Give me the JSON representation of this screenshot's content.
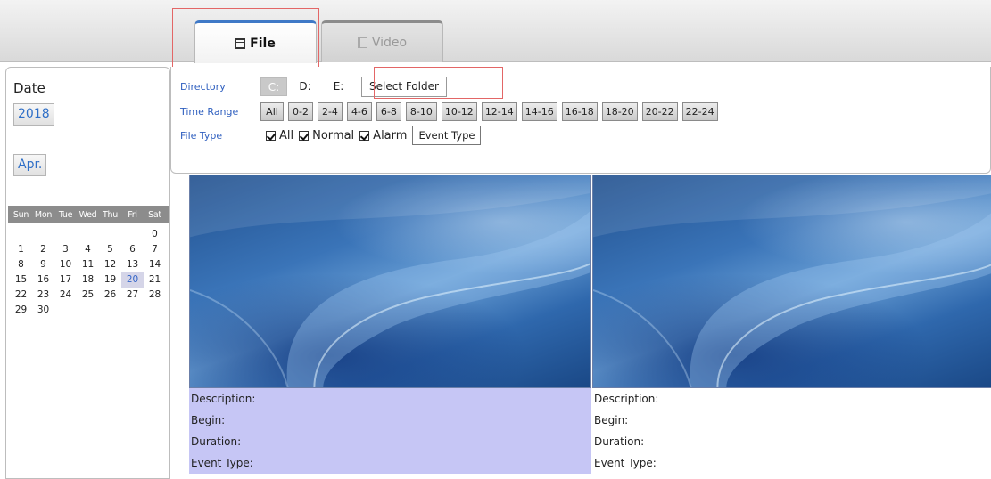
{
  "tabs": [
    {
      "label": "File",
      "active": true
    },
    {
      "label": "Video",
      "active": false
    }
  ],
  "left": {
    "date_label": "Date",
    "year": "2018",
    "month": "Apr.",
    "weekdays": [
      "Sun",
      "Mon",
      "Tue",
      "Wed",
      "Thu",
      "Fri",
      "Sat"
    ],
    "days": [
      "",
      "",
      "",
      "",
      "",
      "",
      "0",
      "1",
      "2",
      "3",
      "4",
      "5",
      "6",
      "7",
      "8",
      "9",
      "10",
      "11",
      "12",
      "13",
      "14",
      "15",
      "16",
      "17",
      "18",
      "19",
      "20",
      "21",
      "22",
      "23",
      "24",
      "25",
      "26",
      "27",
      "28",
      "29",
      "30"
    ],
    "selected_day": "20"
  },
  "filter": {
    "directory_label": "Directory",
    "drive_c": "C:",
    "drive_d": "D:",
    "drive_e": "E:",
    "select_folder": "Select Folder",
    "time_range_label": "Time Range",
    "time_ranges": [
      "All",
      "0-2",
      "2-4",
      "4-6",
      "6-8",
      "8-10",
      "10-12",
      "12-14",
      "14-16",
      "16-18",
      "18-20",
      "20-22",
      "22-24"
    ],
    "file_type_label": "File Type",
    "file_types": [
      "All",
      "Normal",
      "Alarm"
    ],
    "event_type_button": "Event Type"
  },
  "cards": [
    {
      "description": "Description:",
      "begin": "Begin:",
      "duration": "Duration:",
      "event_type": "Event Type:"
    },
    {
      "description": "Description:",
      "begin": "Begin:",
      "duration": "Duration:",
      "event_type": "Event Type:"
    }
  ],
  "colors": {
    "accent": "#3f79c7",
    "link_blue": "#2f6fc7",
    "selected_card": "#c6c6f5",
    "highlight_box": "#e36666"
  }
}
